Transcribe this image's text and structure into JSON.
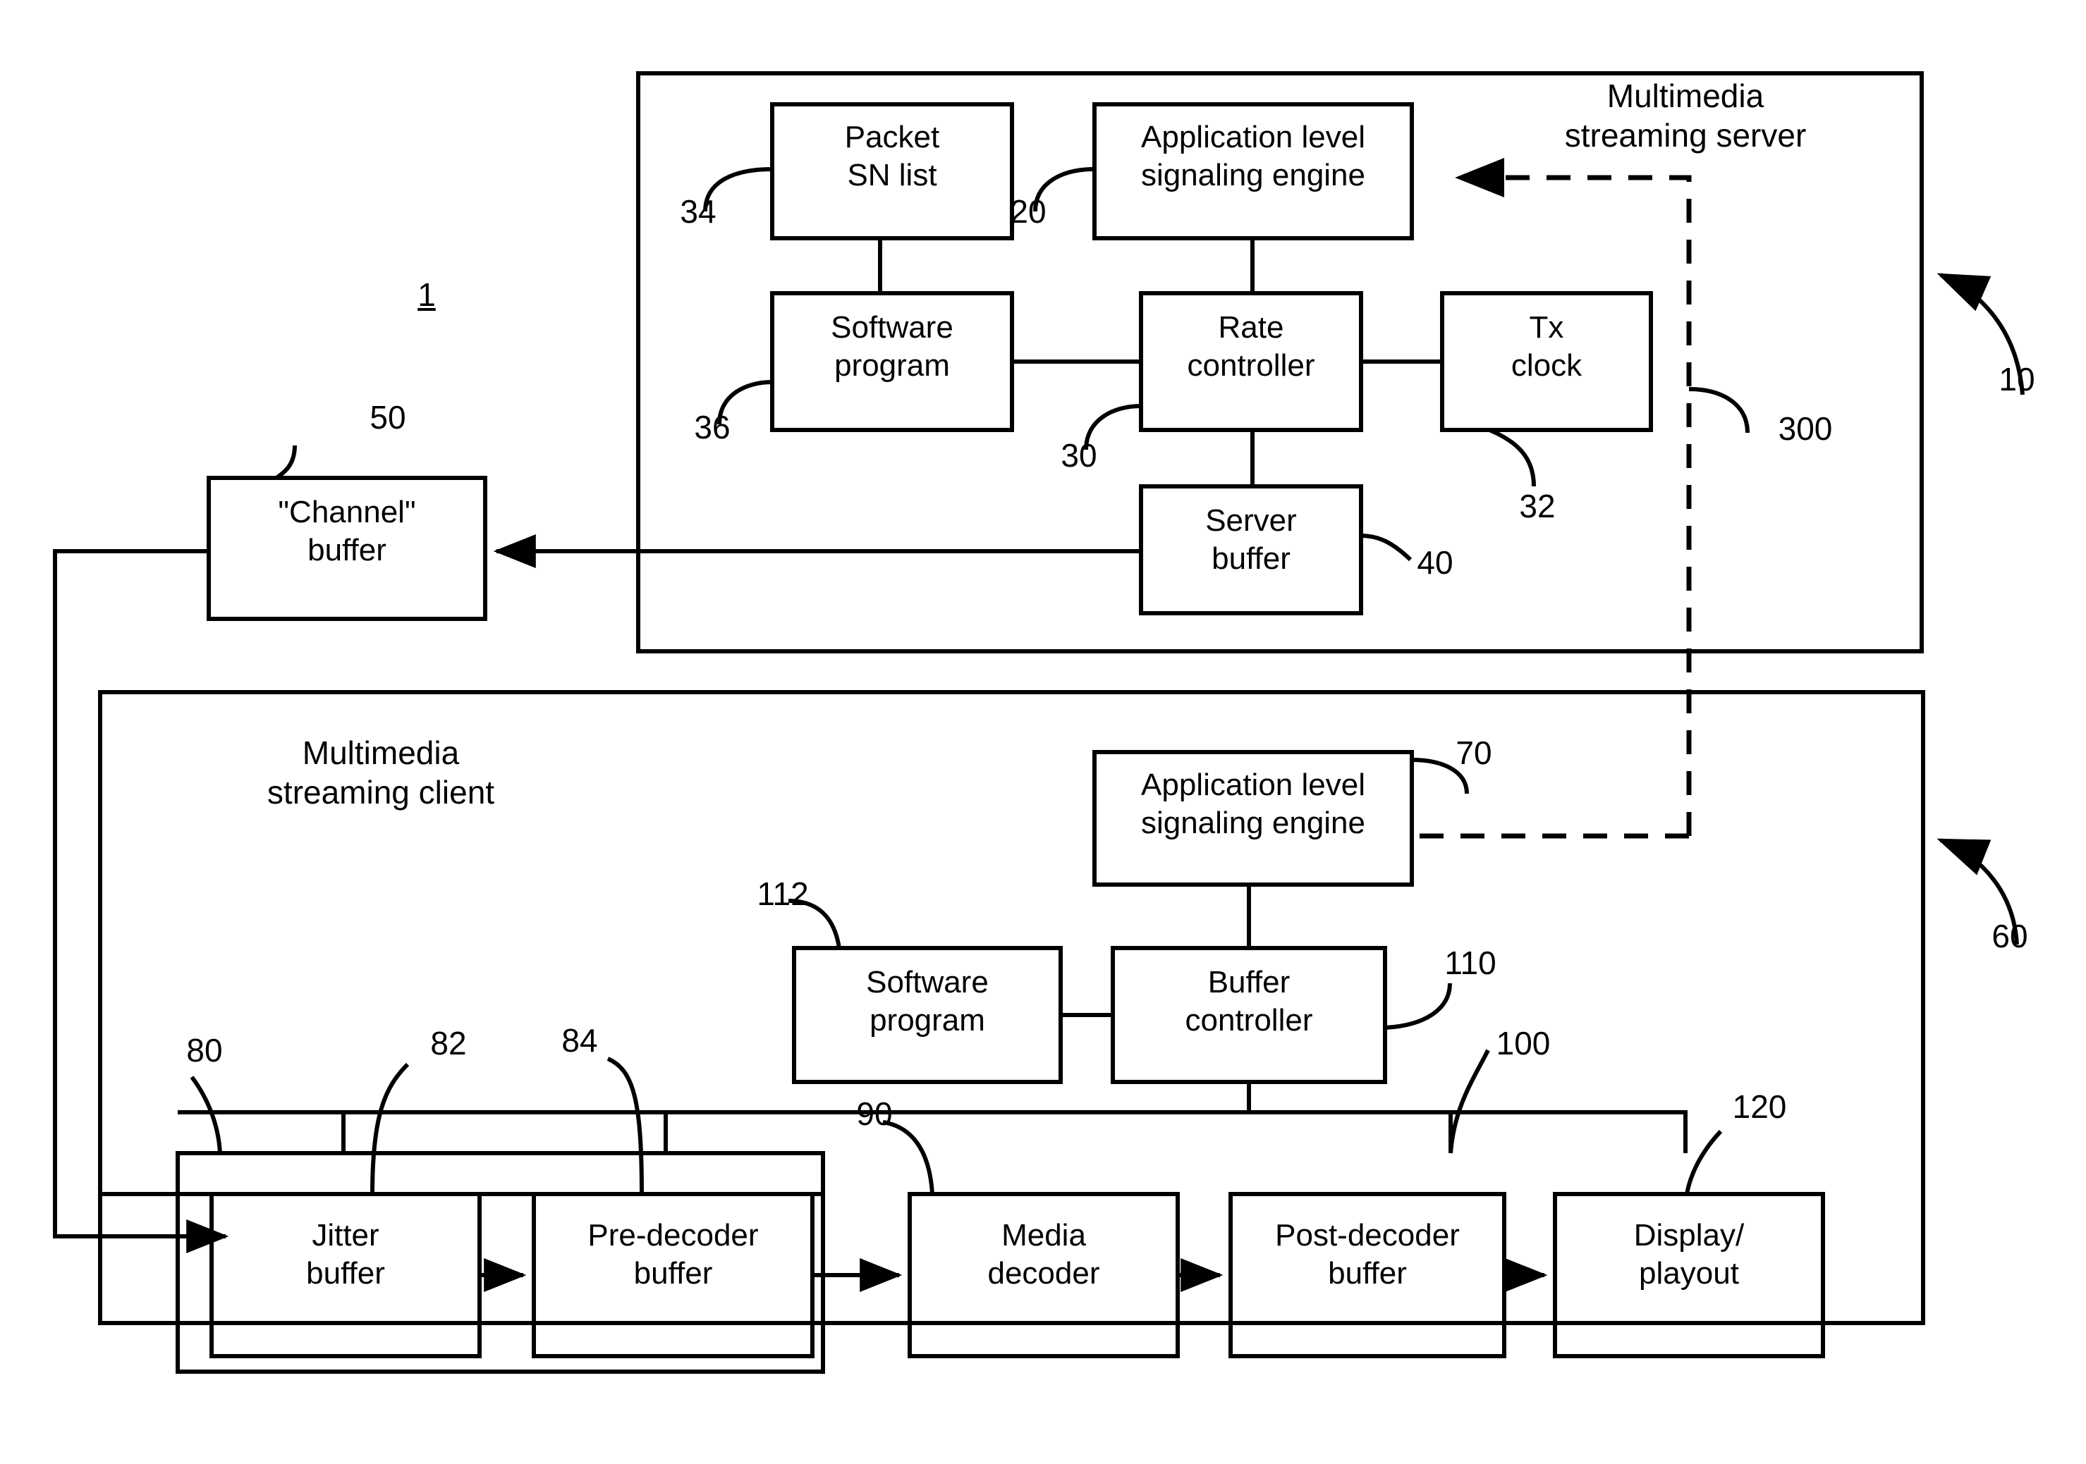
{
  "figure": {
    "figure_number": "1"
  },
  "server": {
    "title": "Multimedia\nstreaming server",
    "ref": "10",
    "boxes": [
      {
        "label": "Packet\nSN list",
        "ref": "34"
      },
      {
        "label": "Application level\nsignaling engine",
        "ref": "20"
      },
      {
        "label": "Software\nprogram",
        "ref": "36"
      },
      {
        "label": "Rate\ncontroller",
        "ref": "30"
      },
      {
        "label": "Tx\nclock",
        "ref": "32"
      },
      {
        "label": "Server\nbuffer",
        "ref": "40"
      }
    ]
  },
  "channel": {
    "label": "\"Channel\"\nbuffer",
    "ref": "50"
  },
  "signaling_link": {
    "ref": "300"
  },
  "client": {
    "title": "Multimedia\nstreaming client",
    "ref": "60",
    "boxes": [
      {
        "label": "Application level\nsignaling engine",
        "ref": "70"
      },
      {
        "label": "Software\nprogram",
        "ref": "112"
      },
      {
        "label": "Buffer\ncontroller",
        "ref": "110"
      },
      {
        "label": "Jitter\nbuffer",
        "ref": "82"
      },
      {
        "label": "Pre-decoder\nbuffer",
        "ref": "84"
      },
      {
        "label": "Media\ndecoder",
        "ref": "90"
      },
      {
        "label": "Post-decoder\nbuffer",
        "ref": "100"
      },
      {
        "label": "Display/\nplayout",
        "ref": "120"
      }
    ],
    "buffer_group_ref": "80"
  }
}
